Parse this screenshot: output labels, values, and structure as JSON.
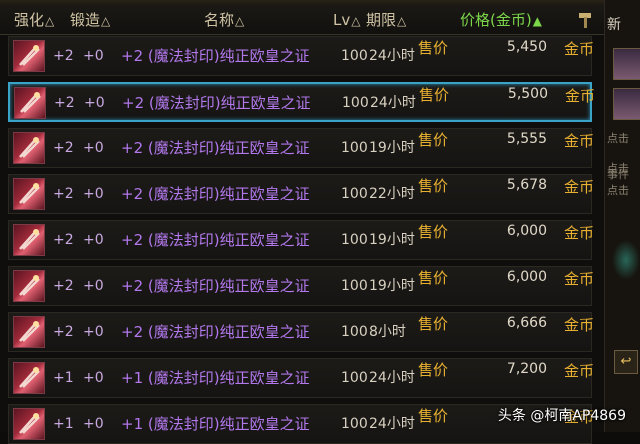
{
  "header": {
    "strengthen": "强化",
    "forge": "锻造",
    "name": "名称",
    "level": "Lv",
    "period": "期限",
    "price": "价格(金币)",
    "sort_mark": "△",
    "sort_mark_active": "▲"
  },
  "rows": [
    {
      "strengthen": "+2",
      "forge": "+0",
      "name": "+2 (魔法封印)纯正欧皇之证",
      "level": "100",
      "period": "24小时",
      "price_label": "售价",
      "price": "5,450",
      "currency": "金币",
      "selected": false
    },
    {
      "strengthen": "+2",
      "forge": "+0",
      "name": "+2 (魔法封印)纯正欧皇之证",
      "level": "100",
      "period": "24小时",
      "price_label": "售价",
      "price": "5,500",
      "currency": "金币",
      "selected": true
    },
    {
      "strengthen": "+2",
      "forge": "+0",
      "name": "+2 (魔法封印)纯正欧皇之证",
      "level": "100",
      "period": "19小时",
      "price_label": "售价",
      "price": "5,555",
      "currency": "金币",
      "selected": false
    },
    {
      "strengthen": "+2",
      "forge": "+0",
      "name": "+2 (魔法封印)纯正欧皇之证",
      "level": "100",
      "period": "22小时",
      "price_label": "售价",
      "price": "5,678",
      "currency": "金币",
      "selected": false
    },
    {
      "strengthen": "+2",
      "forge": "+0",
      "name": "+2 (魔法封印)纯正欧皇之证",
      "level": "100",
      "period": "19小时",
      "price_label": "售价",
      "price": "6,000",
      "currency": "金币",
      "selected": false
    },
    {
      "strengthen": "+2",
      "forge": "+0",
      "name": "+2 (魔法封印)纯正欧皇之证",
      "level": "100",
      "period": "19小时",
      "price_label": "售价",
      "price": "6,000",
      "currency": "金币",
      "selected": false
    },
    {
      "strengthen": "+2",
      "forge": "+0",
      "name": "+2 (魔法封印)纯正欧皇之证",
      "level": "100",
      "period": "8小时",
      "price_label": "售价",
      "price": "6,666",
      "currency": "金币",
      "selected": false
    },
    {
      "strengthen": "+1",
      "forge": "+0",
      "name": "+1 (魔法封印)纯正欧皇之证",
      "level": "100",
      "period": "24小时",
      "price_label": "售价",
      "price": "7,200",
      "currency": "金币",
      "selected": false
    },
    {
      "strengthen": "+1",
      "forge": "+0",
      "name": "+1 (魔法封印)纯正欧皇之证",
      "level": "100",
      "period": "24小时",
      "price_label": "售价",
      "price": "",
      "currency": "金币",
      "selected": false
    }
  ],
  "side": {
    "labels": [
      "新",
      "点击",
      "点击",
      "事件",
      "点击"
    ]
  },
  "watermark": "头条 @柯南AP4869",
  "colors": {
    "accent": "#3aa4c8",
    "price_header": "#7cd64a",
    "gold": "#e8b030",
    "item_name": "#b278ec"
  }
}
